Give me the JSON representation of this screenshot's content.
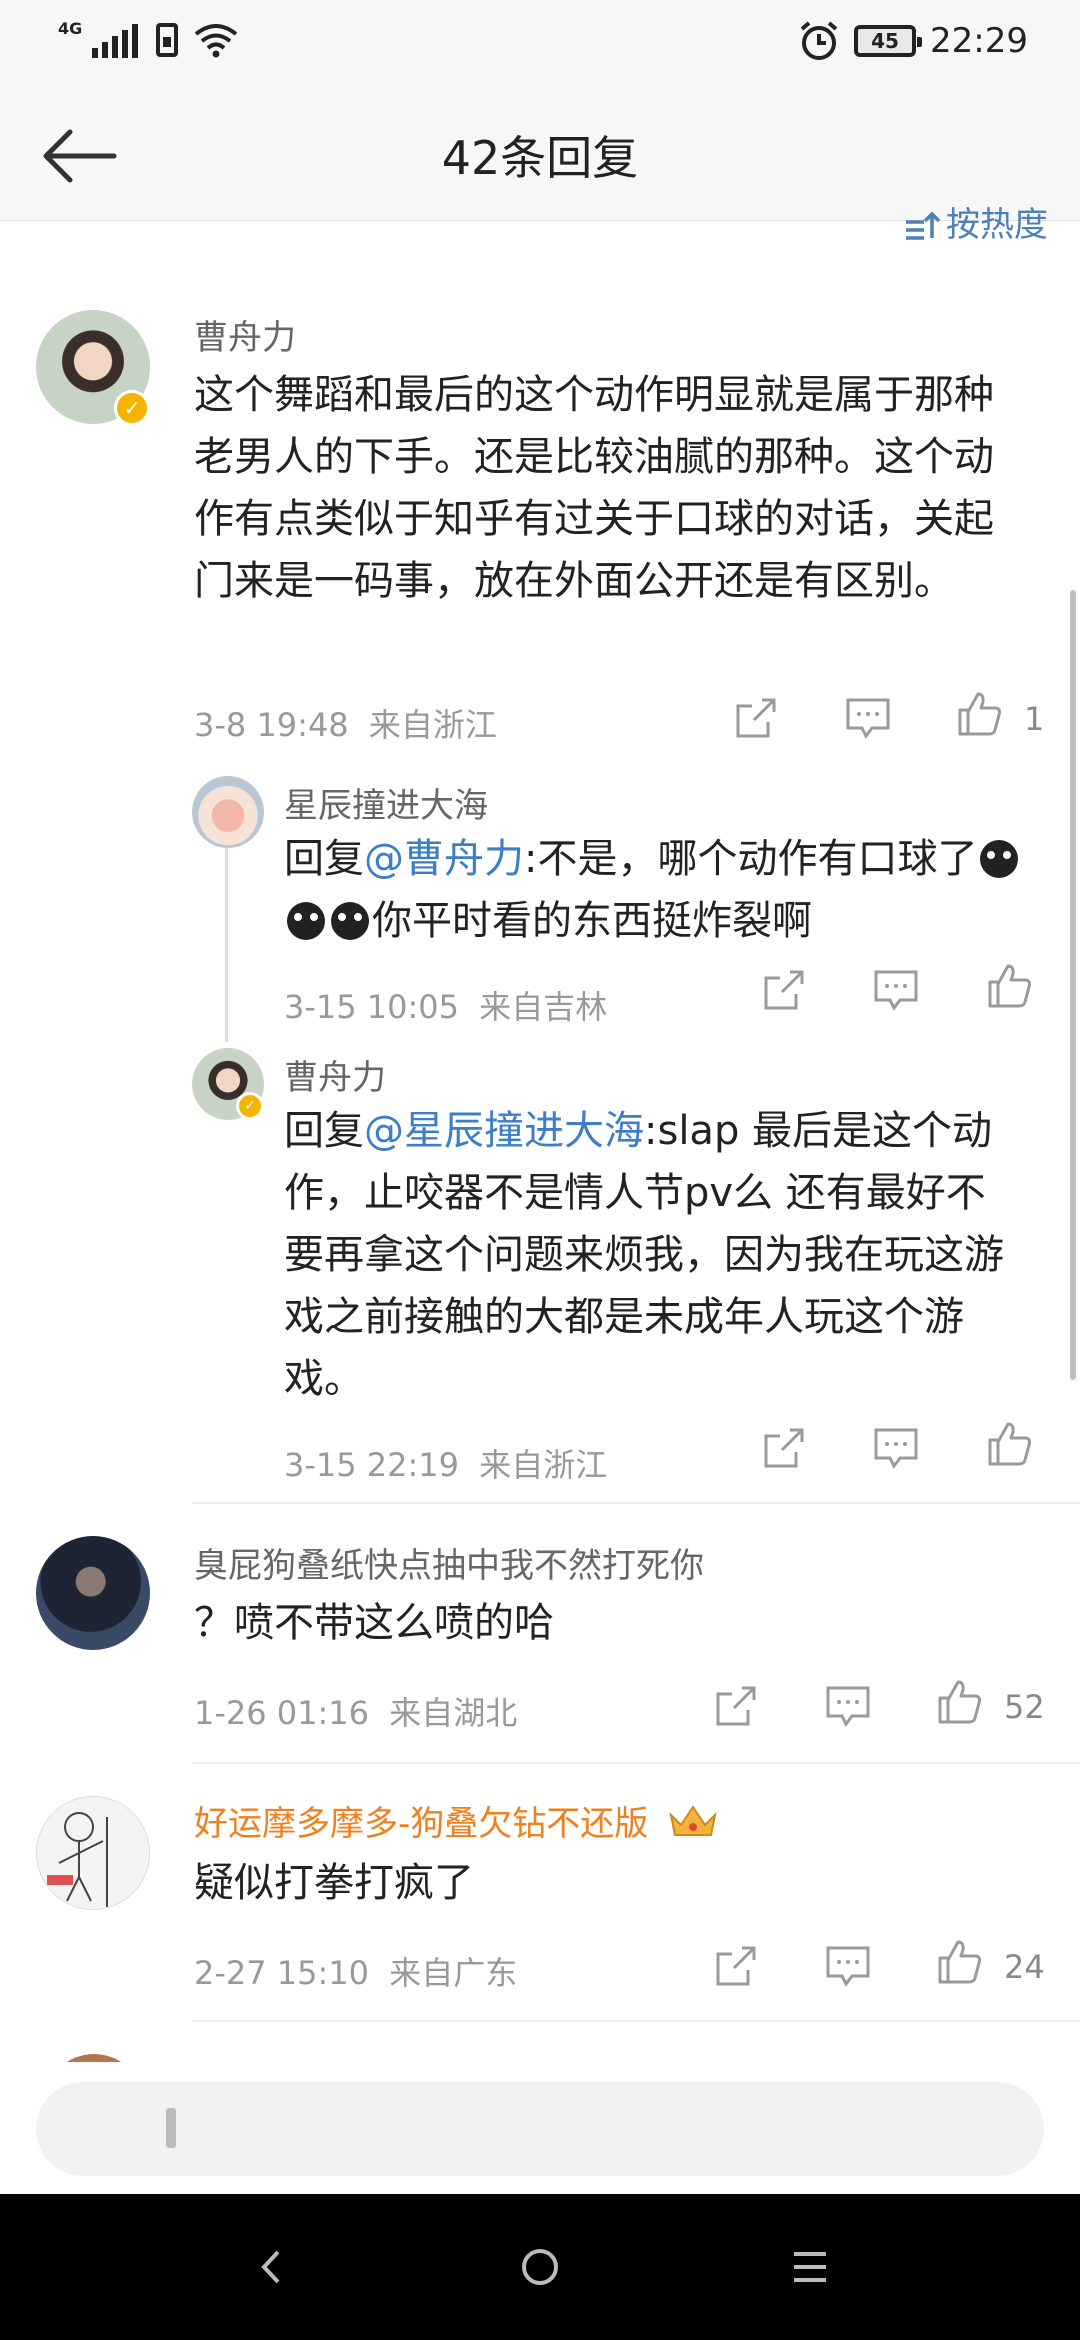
{
  "status_bar": {
    "network": "4G",
    "battery": "45",
    "time": "22:29"
  },
  "header": {
    "title": "42条回复",
    "sort_label": "按热度"
  },
  "comments": [
    {
      "name": "曹舟力",
      "text": "这个舞蹈和最后的这个动作明显就是属于那种老男人的下手。还是比较油腻的那种。这个动作有点类似于知乎有过关于口球的对话，关起门来是一码事，放在外面公开还是有区别。",
      "time": "3-8 19:48",
      "location": "来自浙江",
      "likes": "1",
      "replies": [
        {
          "name": "星辰撞进大海",
          "reply_prefix": "回复",
          "mention": "@曹舟力",
          "text_a": ":不是，哪个动作有口球了",
          "text_b": "你平时看的东西挺炸裂啊",
          "time": "3-15 10:05",
          "location": "来自吉林"
        },
        {
          "name": "曹舟力",
          "reply_prefix": "回复",
          "mention": "@星辰撞进大海",
          "text_a": ":slap 最后是这个动作，止咬器不是情人节pv么 还有最好不要再拿这个问题来烦我，因为我在玩这游戏之前接触的大都是未成年人玩这个游戏。",
          "time": "3-15 22:19",
          "location": "来自浙江"
        }
      ]
    },
    {
      "name": "臭屁狗叠纸快点抽中我不然打死你",
      "text": "？喷不带这么喷的哈",
      "time": "1-26 01:16",
      "location": "来自湖北",
      "likes": "52"
    },
    {
      "name": "好运摩多摩多-狗叠欠钻不还版",
      "text": "疑似打拳打疯了",
      "time": "2-27 15:10",
      "location": "来自广东",
      "likes": "24"
    }
  ],
  "colors": {
    "mention": "#3d7ec6",
    "vip_name": "#f07f1e",
    "meta": "#999999"
  }
}
